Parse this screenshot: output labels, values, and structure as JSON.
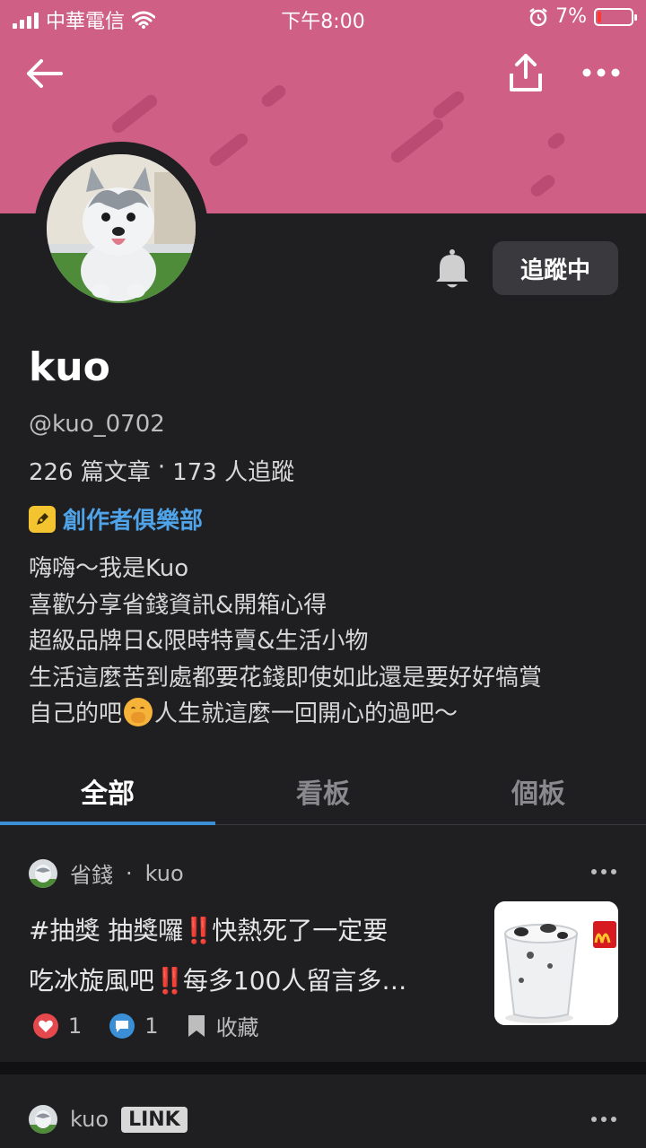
{
  "status_bar": {
    "carrier": "中華電信",
    "time": "下午8:00",
    "battery": "7%",
    "battery_level": 0.07
  },
  "profile": {
    "name": "kuo",
    "handle": "@kuo_0702",
    "articles": "226 篇文章",
    "separator": "·",
    "followers": "173 人追蹤",
    "follow_label": "追蹤中",
    "club_label": "創作者俱樂部",
    "bio": {
      "line1": "嗨嗨～我是Kuo",
      "line2": "喜歡分享省錢資訊&開箱心得",
      "line3": "超級品牌日&限時特賣&生活小物",
      "line4": "生活這麼苦到處都要花錢即使如此還是要好好犒賞",
      "line5a": "自己的吧",
      "line5b": "人生就這麼一回開心的過吧～"
    }
  },
  "tabs": [
    {
      "label": "全部",
      "active": true
    },
    {
      "label": "看板",
      "active": false
    },
    {
      "label": "個板",
      "active": false
    }
  ],
  "posts": [
    {
      "board": "省錢",
      "separator": "·",
      "author": "kuo",
      "line1_text": "#抽獎 抽獎囉",
      "line1_excl": "‼️",
      "line1_tail": "快熱死了一定要",
      "line2_head": "吃冰旋風吧",
      "line2_excl": "‼️",
      "line2_tail": "每多100人留言多…",
      "likes": "1",
      "comments": "1",
      "save_label": "收藏"
    },
    {
      "author": "kuo",
      "badge": "LINK"
    }
  ],
  "colors": {
    "cover": "#d05f85",
    "background": "#1f1f22",
    "accent_blue": "#3b8fd6",
    "club_blue": "#4fa3e8",
    "like_red": "#e5484d"
  }
}
